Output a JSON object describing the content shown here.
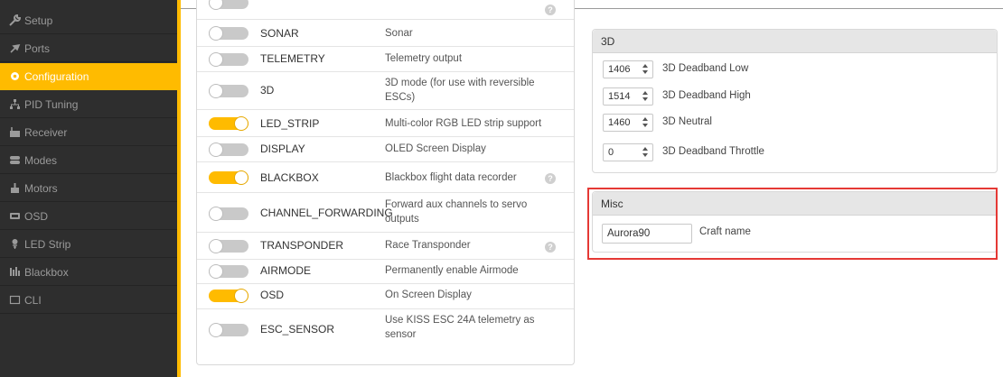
{
  "sidebar": {
    "items": [
      {
        "label": "Setup",
        "icon": "wrench-icon"
      },
      {
        "label": "Ports",
        "icon": "plug-icon"
      },
      {
        "label": "Configuration",
        "icon": "gear-icon",
        "active": true
      },
      {
        "label": "PID Tuning",
        "icon": "pid-icon"
      },
      {
        "label": "Receiver",
        "icon": "receiver-icon"
      },
      {
        "label": "Modes",
        "icon": "modes-icon"
      },
      {
        "label": "Motors",
        "icon": "motor-icon"
      },
      {
        "label": "OSD",
        "icon": "osd-icon"
      },
      {
        "label": "LED Strip",
        "icon": "led-icon"
      },
      {
        "label": "Blackbox",
        "icon": "blackbox-icon"
      },
      {
        "label": "CLI",
        "icon": "terminal-icon"
      }
    ]
  },
  "features": [
    {
      "name": "SONAR",
      "desc": "Sonar",
      "on": false,
      "help": false
    },
    {
      "name": "TELEMETRY",
      "desc": "Telemetry output",
      "on": false,
      "help": false
    },
    {
      "name": "3D",
      "desc": "3D mode (for use with reversible ESCs)",
      "on": false,
      "help": false
    },
    {
      "name": "LED_STRIP",
      "desc": "Multi-color RGB LED strip support",
      "on": true,
      "help": false
    },
    {
      "name": "DISPLAY",
      "desc": "OLED Screen Display",
      "on": false,
      "help": false
    },
    {
      "name": "BLACKBOX",
      "desc": "Blackbox flight data recorder",
      "on": true,
      "help": true
    },
    {
      "name": "CHANNEL_FORWARDING",
      "desc": "Forward aux channels to servo outputs",
      "on": false,
      "help": false
    },
    {
      "name": "TRANSPONDER",
      "desc": "Race Transponder",
      "on": false,
      "help": true
    },
    {
      "name": "AIRMODE",
      "desc": "Permanently enable Airmode",
      "on": false,
      "help": false
    },
    {
      "name": "OSD",
      "desc": "On Screen Display",
      "on": true,
      "help": false
    },
    {
      "name": "ESC_SENSOR",
      "desc": "Use KISS ESC 24A telemetry as sensor",
      "on": false,
      "help": false
    }
  ],
  "help_glyph": "?",
  "three_d": {
    "title": "3D",
    "fields": [
      {
        "value": "1406",
        "label": "3D Deadband Low"
      },
      {
        "value": "1514",
        "label": "3D Deadband High"
      },
      {
        "value": "1460",
        "label": "3D Neutral"
      },
      {
        "value": "0",
        "label": "3D Deadband Throttle"
      }
    ]
  },
  "misc": {
    "title": "Misc",
    "craft_name_value": "Aurora90",
    "craft_name_label": "Craft name"
  },
  "colors": {
    "accent": "#ffbb00",
    "sidebar_bg": "#2e2e2e",
    "highlight": "#e53935"
  }
}
